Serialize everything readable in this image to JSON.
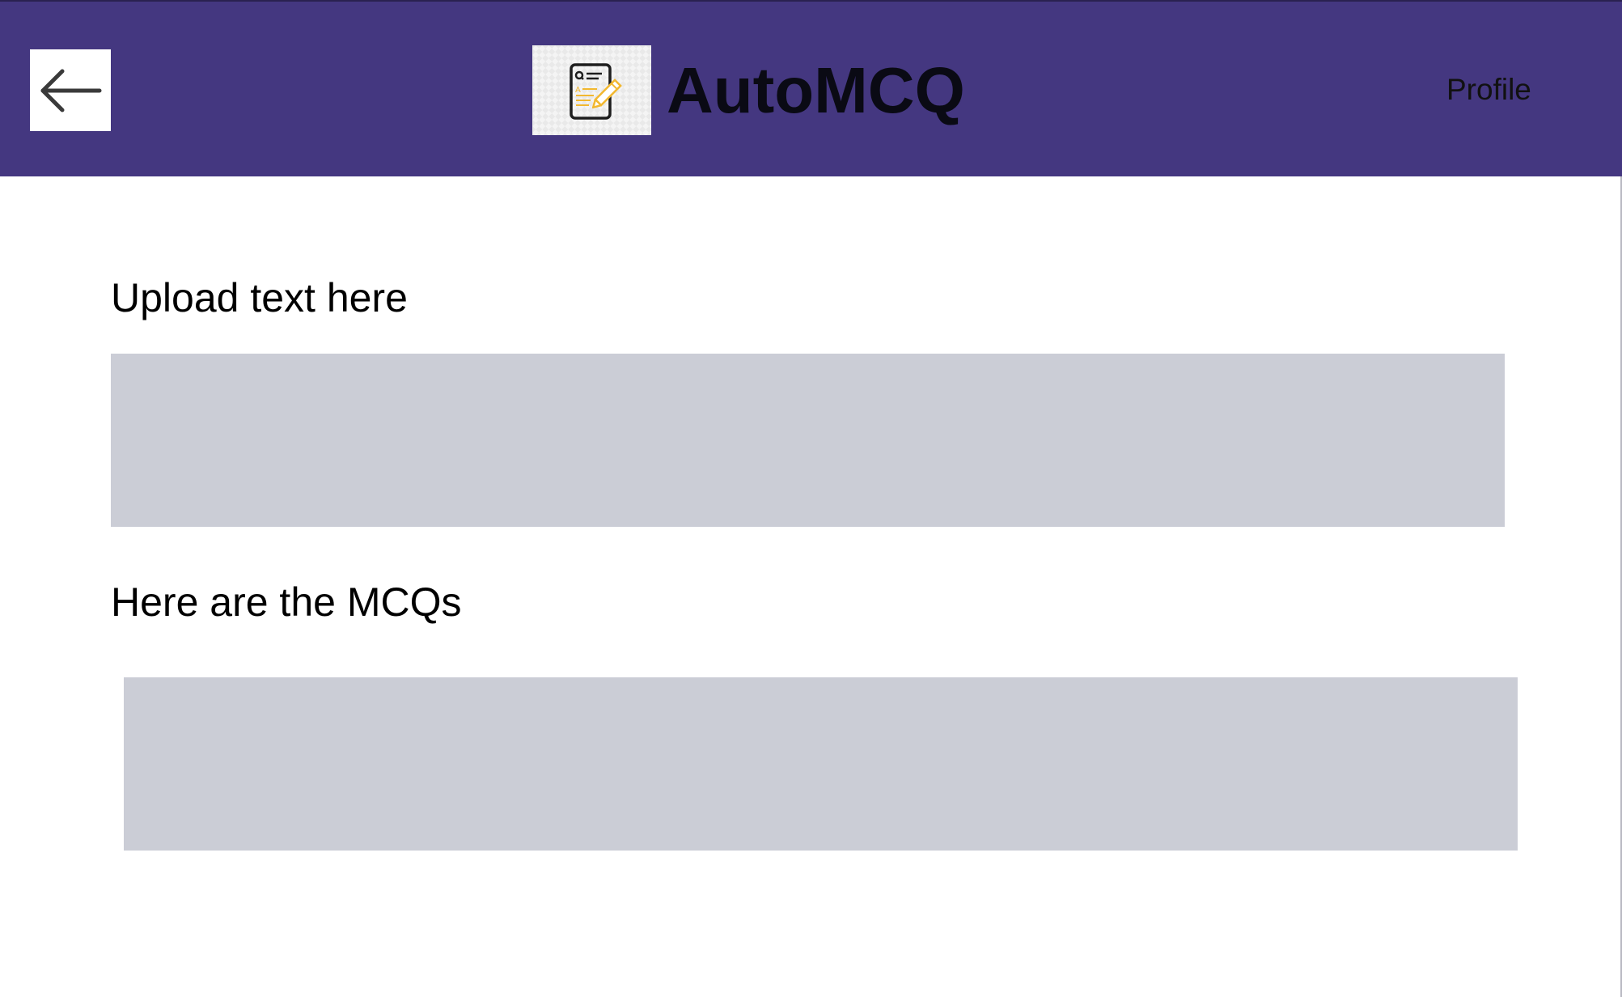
{
  "header": {
    "back_icon": "arrow-left-icon",
    "logo_icon": "document-edit-icon",
    "title": "AutoMCQ",
    "profile_label": "Profile",
    "background_color": "#443780"
  },
  "main": {
    "upload_heading": "Upload text here",
    "upload_value": "",
    "mcq_heading": "Here are the MCQs",
    "mcq_output": "",
    "panel_color": "#cbcdd6"
  }
}
